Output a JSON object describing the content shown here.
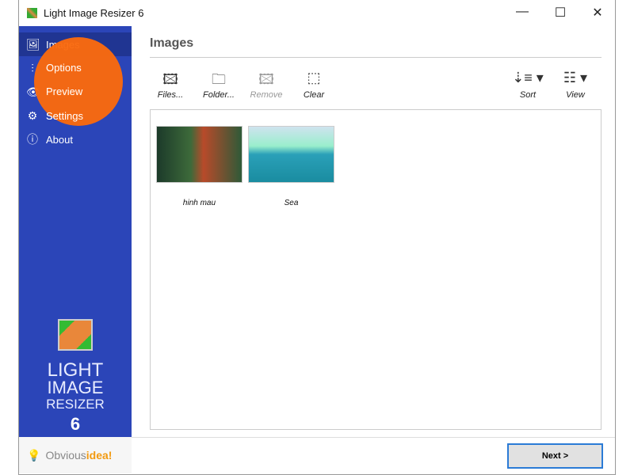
{
  "window": {
    "title": "Light Image Resizer 6",
    "minimize": "—",
    "maximize": "☐",
    "close": "✕"
  },
  "sidebar": {
    "items": [
      {
        "label": "Images",
        "icon": "images-icon"
      },
      {
        "label": "Options",
        "icon": "sliders-icon"
      },
      {
        "label": "Preview",
        "icon": "eye-icon"
      },
      {
        "label": "Settings",
        "icon": "gear-icon"
      },
      {
        "label": "About",
        "icon": "info-icon"
      }
    ],
    "brand": {
      "line1": "LIGHT",
      "line2": "IMAGE",
      "line3": "RESIZER",
      "version": "6"
    },
    "footer_logo": {
      "part1": "Obvious",
      "part2": "idea!"
    }
  },
  "main": {
    "title": "Images",
    "toolbar": {
      "files": "Files...",
      "folder": "Folder...",
      "remove": "Remove",
      "clear": "Clear",
      "sort": "Sort",
      "view": "View"
    },
    "images": [
      {
        "name": "hinh mau"
      },
      {
        "name": "Sea"
      }
    ]
  },
  "footer": {
    "next": "Next >"
  },
  "colors": {
    "sidebar": "#2b45b8",
    "active": "#203592",
    "overlay": "#fb6a0e"
  }
}
